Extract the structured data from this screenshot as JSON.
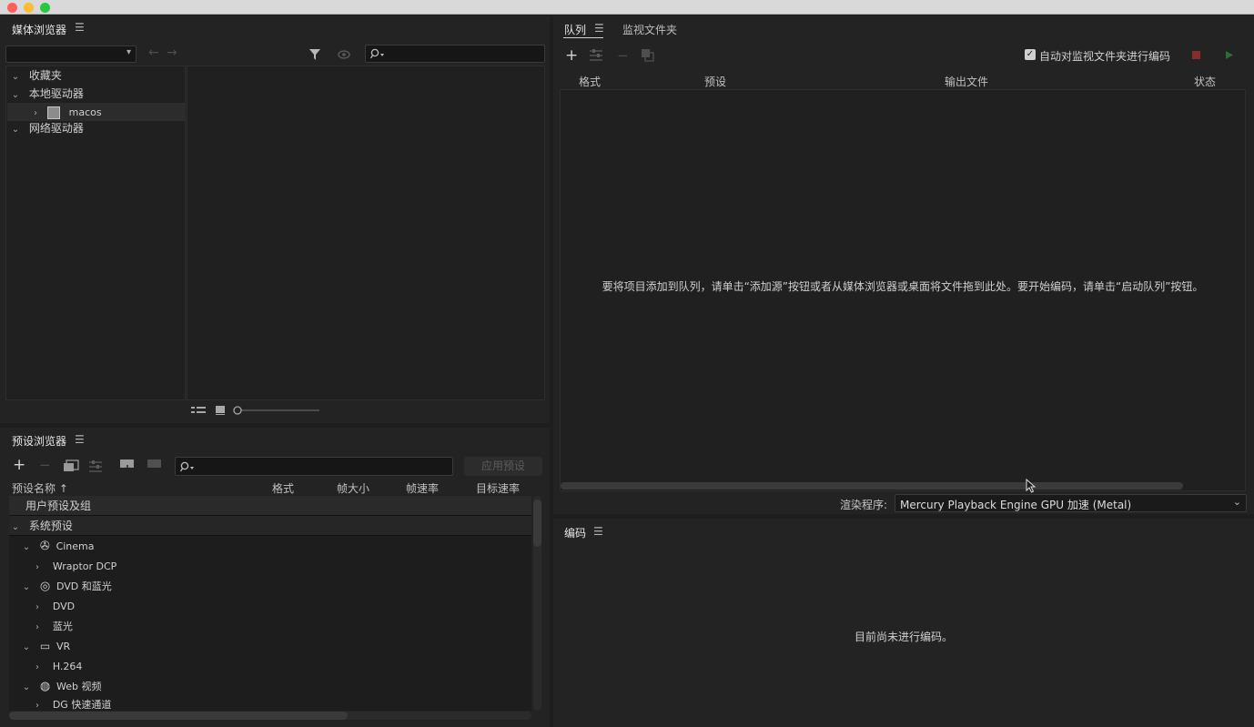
{
  "media_browser": {
    "title": "媒体浏览器",
    "menu_icon": "hamburger-icon",
    "search_placeholder": "",
    "tree": [
      {
        "label": "收藏夹",
        "expanded": true
      },
      {
        "label": "本地驱动器",
        "expanded": true
      },
      {
        "label": "macos",
        "expanded": false
      },
      {
        "label": "网络驱动器",
        "expanded": true
      }
    ]
  },
  "preset_browser": {
    "title": "预设浏览器",
    "apply_label": "应用预设",
    "columns": [
      "预设名称 ↑",
      "格式",
      "帧大小",
      "帧速率",
      "目标速率"
    ],
    "rows": [
      {
        "label": "用户预设及组",
        "level": 0
      },
      {
        "label": "系统预设",
        "level": 0
      },
      {
        "label": "Cinema",
        "level": 1,
        "icon": "film-icon"
      },
      {
        "label": "Wraptor DCP",
        "level": 2
      },
      {
        "label": "DVD 和蓝光",
        "level": 1,
        "icon": "disc-icon"
      },
      {
        "label": "DVD",
        "level": 2
      },
      {
        "label": "蓝光",
        "level": 2
      },
      {
        "label": "VR",
        "level": 1,
        "icon": "vr-headset-icon"
      },
      {
        "label": "H.264",
        "level": 2
      },
      {
        "label": "Web 视频",
        "level": 1,
        "icon": "globe-icon"
      },
      {
        "label": "DG 快速通道",
        "level": 2
      }
    ]
  },
  "queue": {
    "tabs": [
      "队列",
      "监视文件夹"
    ],
    "auto_encode_label": "自动对监视文件夹进行编码",
    "auto_encode_checked": true,
    "columns": [
      "格式",
      "预设",
      "输出文件",
      "状态"
    ],
    "empty_message": "要将项目添加到队列，请单击“添加源”按钮或者从媒体浏览器或桌面将文件拖到此处。要开始编码，请单击“启动队列”按钮。",
    "renderer_label": "渲染程序:",
    "renderer_value": "Mercury Playback Engine GPU 加速 (Metal)"
  },
  "encoding": {
    "title": "编码",
    "empty_message": "目前尚未进行编码。"
  },
  "colors": {
    "panel_bg": "#232323",
    "accent_stop": "#8a2b2b",
    "accent_play": "#2f6b35"
  }
}
